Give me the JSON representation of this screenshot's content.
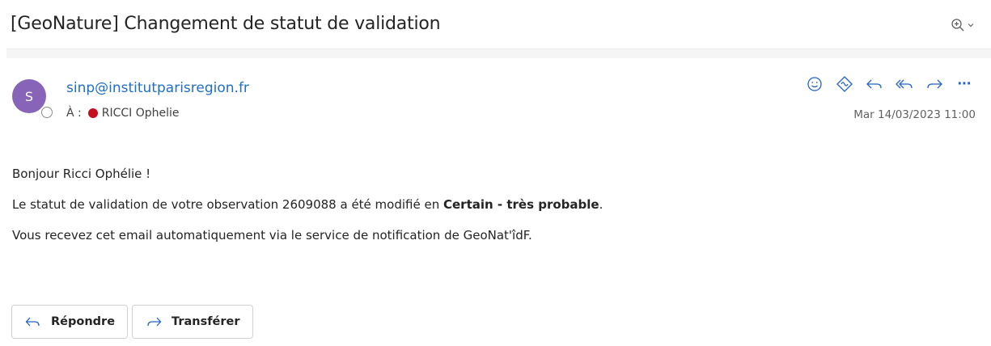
{
  "subject": "[GeoNature] Changement de statut de validation",
  "header": {
    "avatar_initial": "S",
    "sender": "sinp@institutparisregion.fr",
    "to_label": "À :",
    "recipient": "RICCI Ophelie",
    "date": "Mar 14/03/2023 11:00",
    "actions": [
      "smile-icon",
      "loop-icon",
      "reply-icon",
      "reply-all-icon",
      "forward-icon",
      "more-icon"
    ],
    "more_label": "···"
  },
  "message": {
    "greeting": "Bonjour Ricci Ophélie !",
    "line2_before": "Le statut de validation de votre observation 2609088 a été modifié en ",
    "line2_bold": "Certain - très probable",
    "line2_after": ".",
    "line3": "Vous recevez cet email automatiquement via le service de notification de GeoNat'îdF."
  },
  "buttons": {
    "reply": "Répondre",
    "forward": "Transférer"
  },
  "colors": {
    "accent": "#2264c4",
    "link": "#1f6fc5",
    "avatar": "#8764b8",
    "status_dot": "#c50f1f"
  }
}
